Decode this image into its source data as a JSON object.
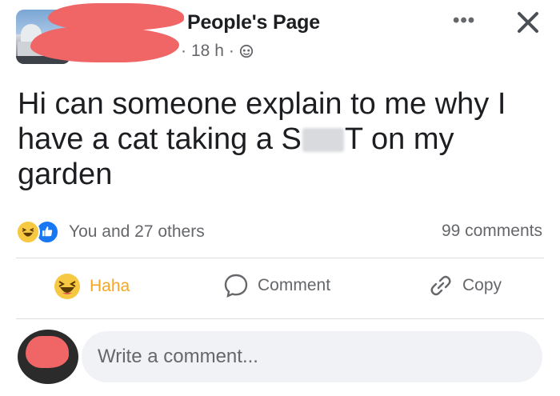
{
  "header": {
    "page_name": "People's Page",
    "time": "18 h",
    "separator": "·",
    "more_label": "•••",
    "close_label": "×"
  },
  "post": {
    "line1": "Hi can someone explain to me why I",
    "line2a": "have a cat taking a S",
    "line2b": "T on my",
    "line3": "garden"
  },
  "stats": {
    "reactions_text": "You and 27 others",
    "comments_text": "99 comments"
  },
  "actions": {
    "haha": "Haha",
    "comment": "Comment",
    "copy": "Copy"
  },
  "comment_input": {
    "placeholder": "Write a comment..."
  },
  "colors": {
    "haha_accent": "#f5a623",
    "like_blue": "#1877f2",
    "redaction_red": "#f06565",
    "muted_text": "#65676b"
  },
  "icons": [
    "globe-icon",
    "more-icon",
    "close-icon",
    "haha-reaction-icon",
    "like-reaction-icon",
    "comment-icon",
    "copy-link-icon"
  ]
}
